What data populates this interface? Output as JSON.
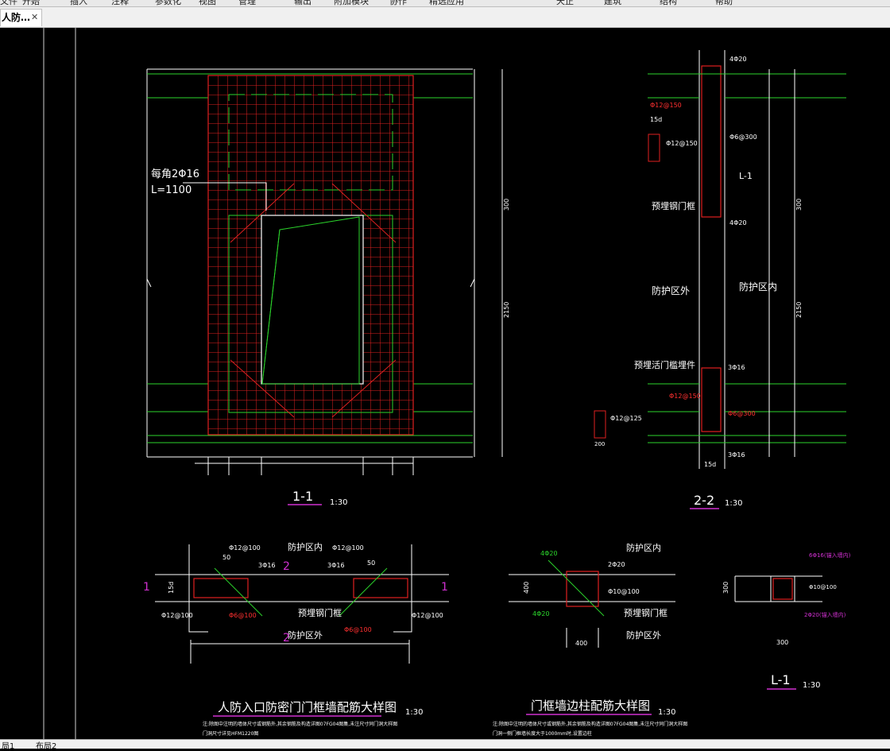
{
  "app": {
    "doc_tab_title": "人防…",
    "doc_tab_close": "✕"
  },
  "menubar": [
    "文件",
    "开始",
    "插入",
    "注释",
    "参数化",
    "视图",
    "管理",
    "输出",
    "附加模块",
    "协作",
    "精选应用",
    "天正",
    "建筑",
    "结构",
    "帮助"
  ],
  "layout_tabs": [
    "局1",
    "布局2"
  ],
  "drawing": {
    "section_11": {
      "title": "1-1",
      "scale": "1:30",
      "rebar_note": "每角2Φ16",
      "rebar_length": "L=1100",
      "dims_vertical": [
        "300",
        "2150"
      ]
    },
    "section_22": {
      "title": "2-2",
      "scale": "1:30",
      "top_bar": "4Φ20",
      "stirrup_top": "Φ12@150",
      "anchor": "15d",
      "stirrup_mid": "Φ12@150",
      "tie": "Φ6@300",
      "label_l1": "L-1",
      "embedded_frame": "预埋钢门框",
      "bot_bar": "4Φ20",
      "outside_zone": "防护区外",
      "inside_zone": "防护区内",
      "embedded_plate": "预埋活门槛埋件",
      "sill_bar_top": "3Φ16",
      "sill_stirrup": "Φ12@150",
      "sill_tie": "Φ6@300",
      "detail_stirrup": "Φ12@125",
      "detail_dim": "200",
      "sill_bar_bot": "3Φ16",
      "anchor_bot": "15d",
      "dims_vertical": [
        "300",
        "2150"
      ]
    },
    "plan_a": {
      "title": "人防入口防密门门框墙配筋大样图",
      "scale": "1:30",
      "inside_zone": "防护区内",
      "outside_zone": "防护区外",
      "stirrup_1": "Φ12@100",
      "stirrup_2": "Φ12@100",
      "dim_50a": "50",
      "dim_50b": "50",
      "bar_3a": "3Φ16",
      "bar_3b": "3Φ16",
      "cut_2": "2",
      "cut_1": "1",
      "frame": "预埋钢门框",
      "tie_a": "Φ6@100",
      "tie_b": "Φ6@100",
      "stirrup_3": "Φ12@100",
      "stirrup_4": "Φ12@100",
      "dim_15d": "15d",
      "note_1": "注:除图中注明的墙体尺寸或钢筋外,其余钢筋及构造详图07FG04图集,未注尺寸同门洞大样图",
      "note_2": "门洞尺寸详见HFM1220图"
    },
    "plan_b": {
      "title": "门框墙边柱配筋大样图",
      "scale": "1:30",
      "inside_zone": "防护区内",
      "outside_zone": "防护区外",
      "bar_top": "4Φ20",
      "bar_2": "2Φ20",
      "stirrup": "Φ10@100",
      "bar_bot": "4Φ20",
      "frame": "预埋钢门框",
      "dim_400a": "400",
      "dim_400b": "400",
      "note_1": "注:除图中注明的墙体尺寸或钢筋外,其余钢筋及构造详图07FG04图集,未注尺寸同门洞大样图",
      "note_2": "门洞一侧门框墙长度大于1000mm时,设置边柱"
    },
    "beam_l1": {
      "title": "L-1",
      "scale": "1:30",
      "bar_top": "6Φ16(锚入墙内)",
      "stirrup": "Φ10@100",
      "bar_bot": "2Φ20(锚入墙内)",
      "dim_h": "300",
      "dim_w": "300"
    }
  }
}
